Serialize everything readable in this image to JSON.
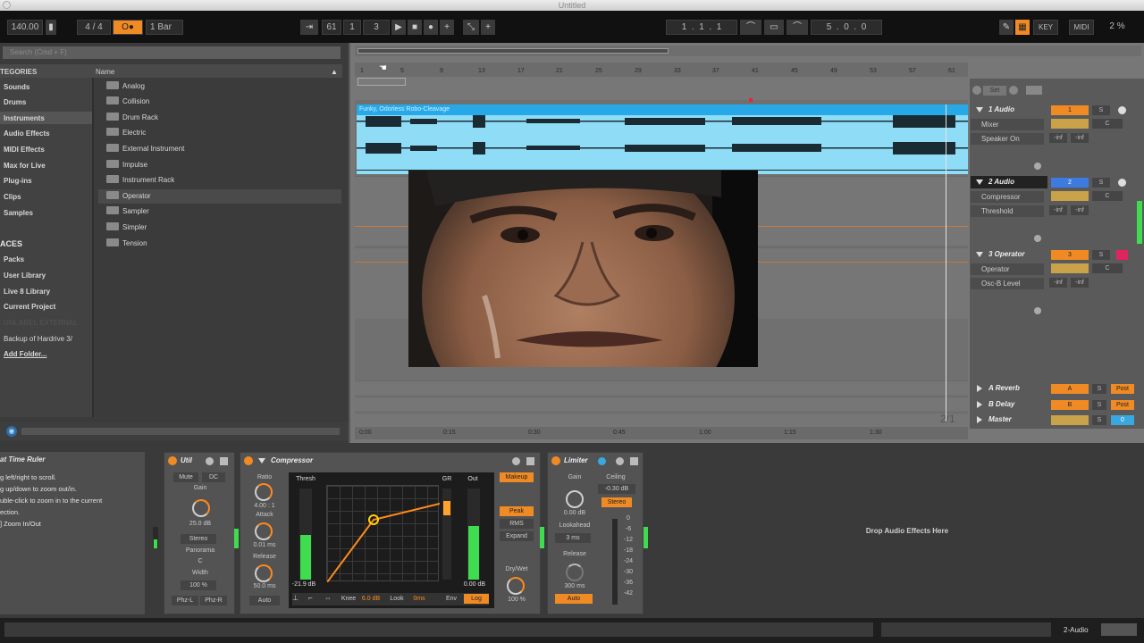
{
  "window": {
    "title": "Untitled"
  },
  "control_bar": {
    "tempo": "140.00",
    "signature": "4 / 4",
    "quantize": "1 Bar",
    "metronome": "O●",
    "position": [
      "61",
      "1",
      "3"
    ],
    "loop_start": [
      "1",
      "1",
      "1"
    ],
    "loop_length": [
      "5",
      "0",
      "0"
    ],
    "key_label": "KEY",
    "midi_label": "MIDI",
    "cpu": "2 %"
  },
  "browser": {
    "search_placeholder": "Search (Cmd + F)",
    "categories_header": "TEGORIES",
    "name_header": "Name",
    "categories": [
      "Sounds",
      "Drums",
      "Instruments",
      "Audio Effects",
      "MIDI Effects",
      "Max for Live",
      "Plug-ins",
      "Clips",
      "Samples"
    ],
    "places_header": "ACES",
    "places": [
      "Packs",
      "User Library",
      "Live 8 Library",
      "Current Project",
      "UNLABEL EXTERNAL",
      "Backup of Hardrive 3/",
      "Add Folder..."
    ],
    "instruments": [
      "Analog",
      "Collision",
      "Drum Rack",
      "Electric",
      "External Instrument",
      "Impulse",
      "Instrument Rack",
      "Operator",
      "Sampler",
      "Simpler",
      "Tension"
    ]
  },
  "arrangement": {
    "ruler": [
      "1",
      "5",
      "9",
      "13",
      "17",
      "21",
      "25",
      "29",
      "33",
      "37",
      "41",
      "45",
      "49",
      "53",
      "57",
      "61"
    ],
    "clip_name": "Funky, Odorless Robo-Cleavage",
    "time_ruler": [
      "0:00",
      "0:15",
      "0:30",
      "0:45",
      "1:00",
      "1:15",
      "1:30"
    ],
    "zoom_readout": "2/1"
  },
  "tracks": [
    {
      "name": "1 Audio",
      "number": "1",
      "device": "Mixer",
      "param": "Speaker On",
      "vol": "-inf",
      "pan": "-inf",
      "color": "#f08a24"
    },
    {
      "name": "2 Audio",
      "number": "2",
      "device": "Compressor",
      "param": "Threshold",
      "vol": "-inf",
      "pan": "-inf",
      "color": "#3d7be0"
    },
    {
      "name": "3 Operator",
      "number": "3",
      "device": "Operator",
      "param": "Osc-B Level",
      "vol": "-inf",
      "pan": "-inf",
      "color": "#f08a24"
    }
  ],
  "returns": [
    {
      "name": "A Reverb",
      "letter": "A",
      "post": "Post"
    },
    {
      "name": "B Delay",
      "letter": "B",
      "post": "Post"
    },
    {
      "name": "Master",
      "letter": "0",
      "post": ""
    }
  ],
  "mixer_labels": {
    "set": "Set",
    "s": "S",
    "c": "C"
  },
  "info_view": {
    "title": "at Time Ruler",
    "lines": [
      "g left/right to scroll.",
      "g up/down to zoom out/in.",
      "uble-click to zoom in to the current",
      "ection.",
      "",
      "] Zoom In/Out"
    ]
  },
  "utility": {
    "title": "Util",
    "mute": "Mute",
    "dc": "DC",
    "gain_label": "Gain",
    "gain_value": "25.0 dB",
    "mode": "Stereo",
    "pan_label": "Panorama",
    "pan_value": "C",
    "width_label": "Width",
    "width_value": "100 %",
    "phz_l": "Phz-L",
    "phz_r": "Phz-R"
  },
  "compressor": {
    "title": "Compressor",
    "ratio_label": "Ratio",
    "ratio_value": "4.00 : 1",
    "attack_label": "Attack",
    "attack_value": "0.01 ms",
    "release_label": "Release",
    "release_value": "50.0 ms",
    "auto": "Auto",
    "thresh_label": "Thresh",
    "thresh_value": "-21.9 dB",
    "gr_label": "GR",
    "out_label": "Out",
    "out_value": "0.00 dB",
    "makeup": "Makeup",
    "peak": "Peak",
    "rms": "RMS",
    "expand": "Expand",
    "drywet_label": "Dry/Wet",
    "drywet_value": "100 %",
    "knee_label": "Knee",
    "knee_value": "6.0 dB",
    "look_label": "Look",
    "look_value": "0ms",
    "env_label": "Env",
    "env_value": "Log"
  },
  "limiter": {
    "title": "Limiter",
    "gain_label": "Gain",
    "gain_value": "0.00 dB",
    "ceiling_label": "Ceiling",
    "ceiling_value": "-0.30 dB",
    "stereo": "Stereo",
    "lookahead_label": "Lookahead",
    "lookahead_value": "3 ms",
    "release_label": "Release",
    "release_value": "300 ms",
    "auto": "Auto",
    "scale": [
      "0",
      "-6",
      "-12",
      "-18",
      "-24",
      "-30",
      "-36",
      "-42"
    ]
  },
  "drop_hint": "Drop Audio Effects Here",
  "status": {
    "track": "2-Audio"
  }
}
